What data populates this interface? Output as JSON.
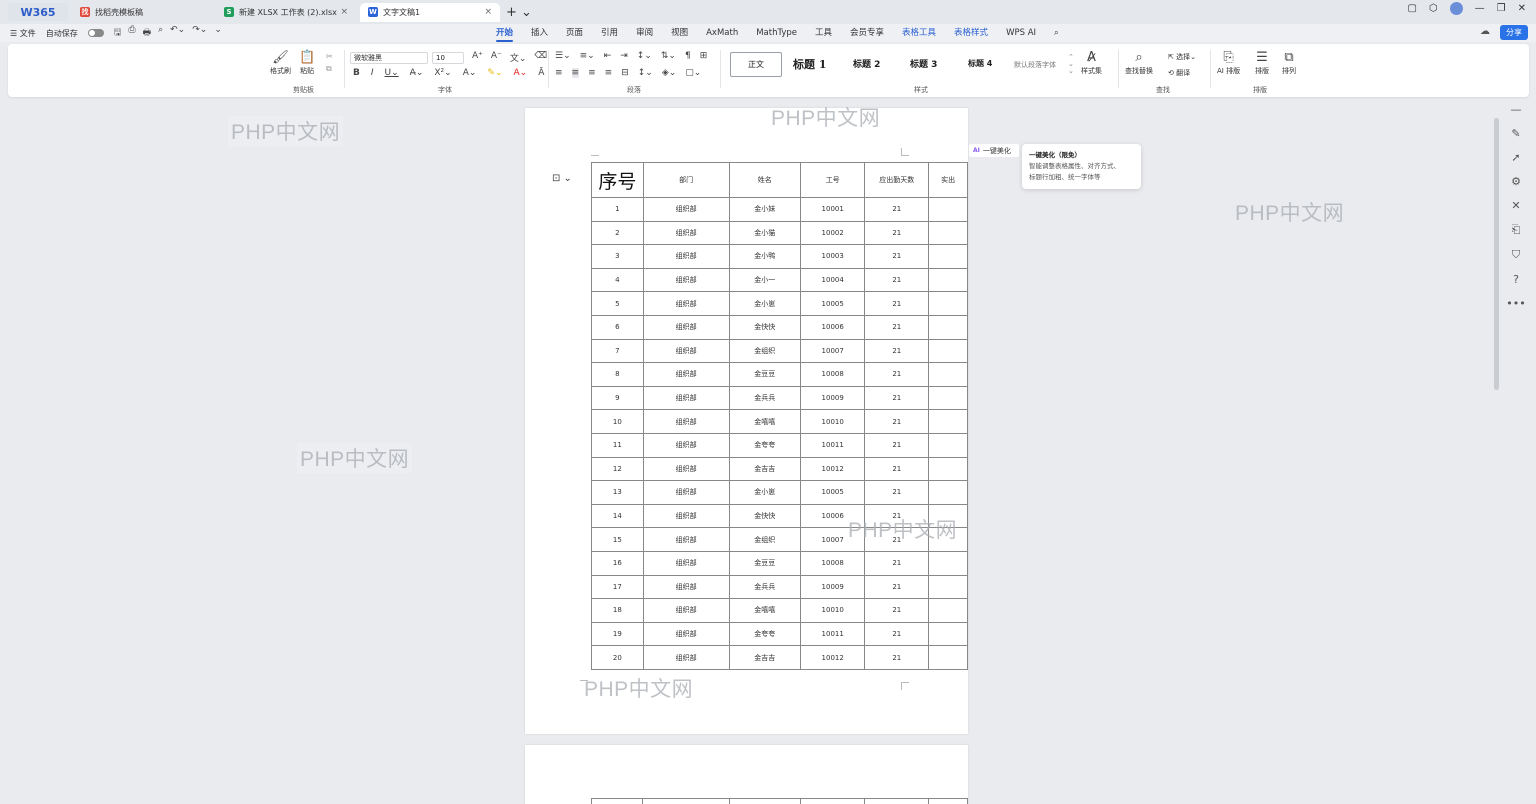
{
  "tabbar": {
    "logo": "W365",
    "tabs": [
      {
        "label": "找稻壳模板稿",
        "icon_color": "#e0483c",
        "icon_char": "找"
      },
      {
        "label": "新建 XLSX 工作表 (2).xlsx",
        "icon_color": "#1f9f5b",
        "icon_char": "S"
      },
      {
        "label": "文字文稿1",
        "icon_color": "#2b63d8",
        "icon_char": "W",
        "active": true
      }
    ],
    "close_glyph": "×",
    "add_glyph": "+ ⌄"
  },
  "menu": {
    "file": "☰ 文件",
    "autosave": "自动保存",
    "tabs": [
      "开始",
      "插入",
      "页面",
      "引用",
      "审阅",
      "视图",
      "AxMath",
      "MathType",
      "工具",
      "会员专享",
      "表格工具",
      "表格样式",
      "WPS AI"
    ],
    "share": "分享"
  },
  "ribbon": {
    "clipboard": {
      "format_painter": "格式刷",
      "paste": "粘贴",
      "label": "剪贴板"
    },
    "font": {
      "name": "微软雅黑",
      "size": "10",
      "label": "字体"
    },
    "paragraph": {
      "label": "段落"
    },
    "styles": {
      "normal": "正文",
      "h1": "标题 1",
      "h2": "标题 2",
      "h3": "标题 3",
      "h4": "标题 4",
      "default_font": "默认段落字体",
      "style_set": "样式集",
      "label": "样式"
    },
    "find": {
      "find_replace": "查找替换",
      "select": "选择",
      "translate": "翻译",
      "label": "查找"
    },
    "arrange": {
      "ai_layout": "AI 排版",
      "layout": "排版",
      "arrange": "排列",
      "label": "排版"
    }
  },
  "watermark": "PHP中文网",
  "ai": {
    "button": "一键美化",
    "badge": "AI",
    "tooltip_title": "一键美化（限免）",
    "tooltip_line1": "智能调整表格属性、对齐方式、",
    "tooltip_line2": "标题行加粗、统一字体等"
  },
  "table": {
    "headers": [
      "序号",
      "部门",
      "姓名",
      "工号",
      "应出勤天数",
      "实出"
    ],
    "rows": [
      [
        "1",
        "组织部",
        "金小妹",
        "10001",
        "21"
      ],
      [
        "2",
        "组织部",
        "金小猫",
        "10002",
        "21"
      ],
      [
        "3",
        "组织部",
        "金小鸭",
        "10003",
        "21"
      ],
      [
        "4",
        "组织部",
        "金小一",
        "10004",
        "21"
      ],
      [
        "5",
        "组织部",
        "金小崽",
        "10005",
        "21"
      ],
      [
        "6",
        "组织部",
        "金快快",
        "10006",
        "21"
      ],
      [
        "7",
        "组织部",
        "金组织",
        "10007",
        "21"
      ],
      [
        "8",
        "组织部",
        "金豆豆",
        "10008",
        "21"
      ],
      [
        "9",
        "组织部",
        "金兵兵",
        "10009",
        "21"
      ],
      [
        "10",
        "组织部",
        "金嘻嘻",
        "10010",
        "21"
      ],
      [
        "11",
        "组织部",
        "金夸夸",
        "10011",
        "21"
      ],
      [
        "12",
        "组织部",
        "金吉吉",
        "10012",
        "21"
      ],
      [
        "13",
        "组织部",
        "金小崽",
        "10005",
        "21"
      ],
      [
        "14",
        "组织部",
        "金快快",
        "10006",
        "21"
      ],
      [
        "15",
        "组织部",
        "金组织",
        "10007",
        "21"
      ],
      [
        "16",
        "组织部",
        "金豆豆",
        "10008",
        "21"
      ],
      [
        "17",
        "组织部",
        "金兵兵",
        "10009",
        "21"
      ],
      [
        "18",
        "组织部",
        "金嘻嘻",
        "10010",
        "21"
      ],
      [
        "19",
        "组织部",
        "金夸夸",
        "10011",
        "21"
      ],
      [
        "20",
        "组织部",
        "金吉吉",
        "10012",
        "21"
      ]
    ]
  }
}
